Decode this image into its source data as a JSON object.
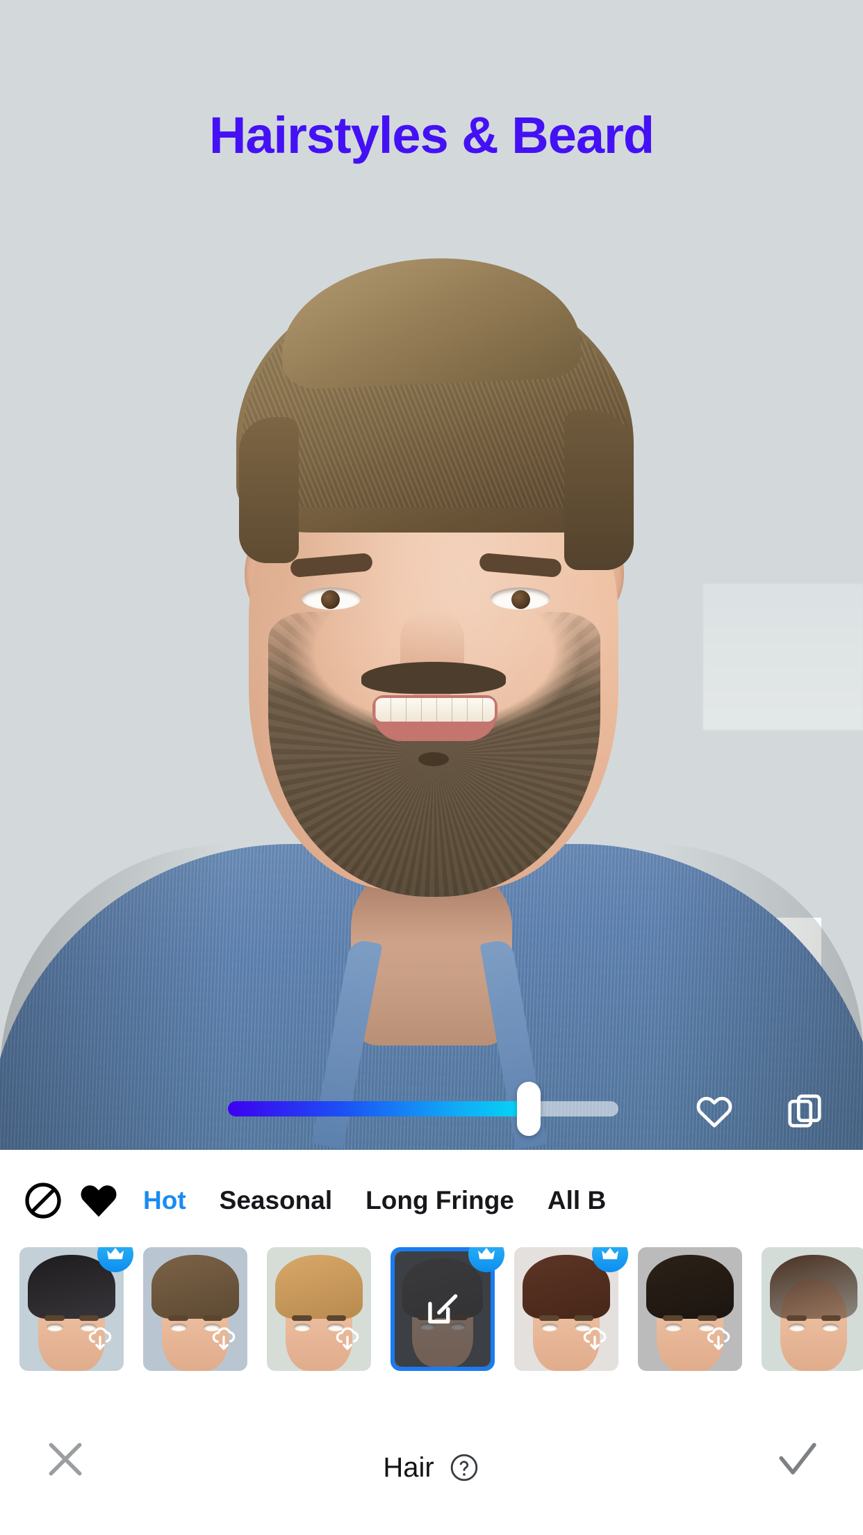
{
  "header": {
    "title": "Hairstyles & Beard",
    "title_color": "#4411f5"
  },
  "canvas": {
    "background_color": "#d3d9db",
    "subject_alt": "portrait-photo-of-smiling-man-with-beard"
  },
  "slider": {
    "name": "intensity-slider",
    "value_percent": 75,
    "fill_gradient_start": "#3d00f0",
    "fill_gradient_end": "#05d6f7",
    "track_color": "#ffffff"
  },
  "overlay_actions": {
    "favorite_icon": "heart-outline-icon",
    "compare_icon": "layers-compare-icon"
  },
  "tabs": {
    "none_icon": "no-symbol-icon",
    "favorites_icon": "heart-filled-icon",
    "active_index": 0,
    "items": [
      {
        "label": "Hot",
        "active": true
      },
      {
        "label": "Seasonal",
        "active": false
      },
      {
        "label": "Long Fringe",
        "active": false
      },
      {
        "label": "All B",
        "active": false
      }
    ]
  },
  "thumbnails": {
    "selected_index": 3,
    "selected_border_color": "#1a7cf0",
    "crown_badge_color": "#0d8ef0",
    "items": [
      {
        "name": "style-1",
        "premium": true,
        "downloadable": true,
        "selected": false,
        "bg": "#c3d0d7",
        "hair": "#1d1c1d",
        "hair2": "#38353a"
      },
      {
        "name": "style-2",
        "premium": false,
        "downloadable": true,
        "selected": false,
        "bg": "#b9c6d2",
        "hair": "#7b6246",
        "hair2": "#5d4a33"
      },
      {
        "name": "style-3",
        "premium": false,
        "downloadable": true,
        "selected": false,
        "bg": "#d6ddd6",
        "hair": "#d8a86a",
        "hair2": "#b98a4e"
      },
      {
        "name": "style-4-edit",
        "premium": true,
        "downloadable": false,
        "selected": true,
        "bg": "#5a5d60",
        "hair": "#55504c",
        "hair2": "#44403d",
        "overlay_icon": "edit-square-icon"
      },
      {
        "name": "style-5",
        "premium": true,
        "downloadable": true,
        "selected": false,
        "bg": "#e4e0dd",
        "hair": "#5c3526",
        "hair2": "#472618"
      },
      {
        "name": "style-6",
        "premium": false,
        "downloadable": true,
        "selected": false,
        "bg": "#bbbbbb",
        "hair": "#2b2117",
        "hair2": "#1c1510"
      },
      {
        "name": "style-7",
        "premium": false,
        "downloadable": false,
        "selected": false,
        "bg": "#d4dcd8",
        "hair": "#4a3122",
        "hair2": "#35221673"
      }
    ]
  },
  "action_bar": {
    "close_icon": "close-x-icon",
    "label": "Hair",
    "help_icon": "question-circle-icon",
    "confirm_icon": "checkmark-icon"
  }
}
